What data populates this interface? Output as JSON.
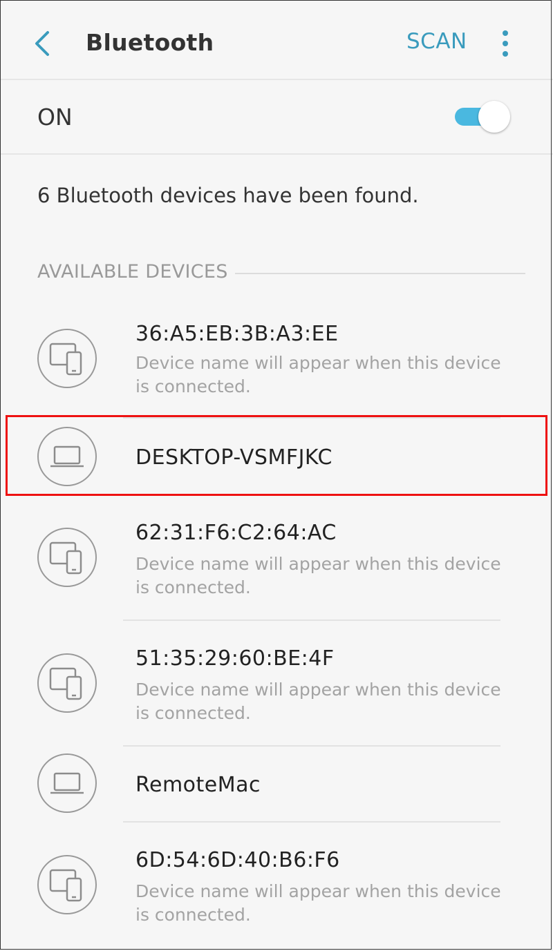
{
  "header": {
    "back_icon": "chevron-left-icon",
    "title": "Bluetooth",
    "scan_label": "SCAN",
    "more_icon": "more-vertical-icon",
    "accent_color": "#3a9bbd"
  },
  "bluetooth": {
    "state_label": "ON",
    "enabled": true
  },
  "status_text": "6 Bluetooth devices have been found.",
  "section_title": "AVAILABLE DEVICES",
  "devices": [
    {
      "name": "36:A5:EB:3B:A3:EE",
      "icon": "devices-icon",
      "desc": "Device name will appear when this device is connected."
    },
    {
      "name": "DESKTOP-VSMFJKC",
      "icon": "laptop-icon",
      "highlighted": true
    },
    {
      "name": "62:31:F6:C2:64:AC",
      "icon": "devices-icon",
      "desc": "Device name will appear when this device is connected."
    },
    {
      "name": "51:35:29:60:BE:4F",
      "icon": "devices-icon",
      "desc": "Device name will appear when this device is connected."
    },
    {
      "name": "RemoteMac",
      "icon": "laptop-icon"
    },
    {
      "name": "6D:54:6D:40:B6:F6",
      "icon": "devices-icon",
      "desc": "Device name will appear when this device is connected."
    }
  ],
  "highlight_color": "#ee1111"
}
